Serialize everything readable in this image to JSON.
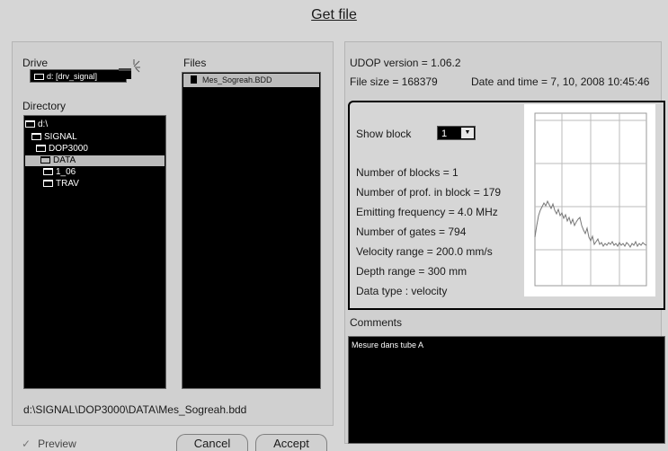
{
  "title": "Get file",
  "drive": {
    "label": "Drive",
    "selected": "d: [drv_signal]"
  },
  "files": {
    "label": "Files",
    "items": [
      "Mes_Sogreah.BDD"
    ]
  },
  "directory": {
    "label": "Directory",
    "items": [
      {
        "name": "d:\\",
        "level": 0,
        "selected": false
      },
      {
        "name": "SIGNAL",
        "level": 1,
        "selected": false
      },
      {
        "name": "DOP3000",
        "level": 2,
        "selected": false
      },
      {
        "name": "DATA",
        "level": 3,
        "selected": true
      },
      {
        "name": "1_06",
        "level": 4,
        "selected": false
      },
      {
        "name": "TRAV",
        "level": 4,
        "selected": false
      }
    ]
  },
  "path": "d:\\SIGNAL\\DOP3000\\DATA\\Mes_Sogreah.bdd",
  "preview": {
    "check": "✓",
    "label": "Preview"
  },
  "buttons": {
    "cancel": "Cancel",
    "accept": "Accept"
  },
  "info": {
    "udop_version": "UDOP version = 1.06.2",
    "file_size": "File size = 168379",
    "date_time": "Date and time = 7, 10, 2008  10:45:46"
  },
  "block": {
    "show_block_label": "Show block",
    "show_block_value": "1",
    "stats": [
      "Number of blocks = 1",
      "Number of prof. in block = 179",
      "Emitting frequency = 4.0 MHz",
      "Number of gates = 794",
      "Velocity range = 200.0 mm/s",
      "Depth range = 300 mm",
      "Data type : velocity"
    ]
  },
  "comments": {
    "label": "Comments",
    "text": "Mesure dans tube A"
  },
  "colors": {
    "background": "#d6d6d6",
    "list_bg": "#000000",
    "selection": "#bcbcbc"
  }
}
